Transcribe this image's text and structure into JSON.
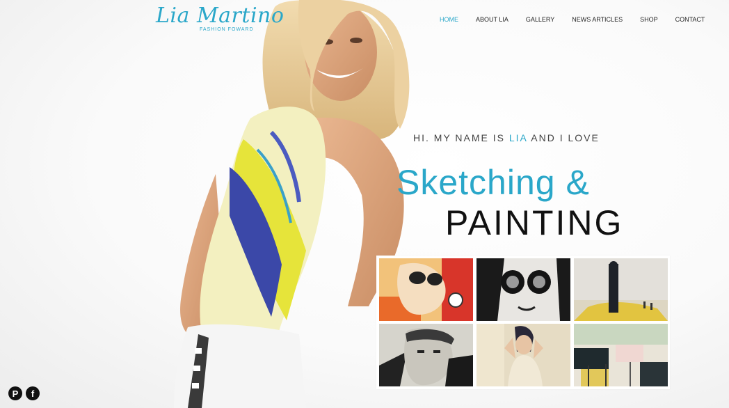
{
  "brand": {
    "name": "Lia Martino",
    "tagline": "FASHION FOWARD",
    "accent_color": "#2aa7c9"
  },
  "nav": {
    "items": [
      {
        "label": "HOME",
        "active": true
      },
      {
        "label": "ABOUT LIA",
        "active": false
      },
      {
        "label": "GALLERY",
        "active": false
      },
      {
        "label": "NEWS ARTICLES",
        "active": false
      },
      {
        "label": "SHOP",
        "active": false
      },
      {
        "label": "CONTACT",
        "active": false
      }
    ]
  },
  "hero": {
    "intro_before": "HI. MY NAME IS ",
    "intro_highlight": "LIA",
    "intro_after": " AND I LOVE",
    "line1": "Sketching &",
    "line2": "PAINTING"
  },
  "gallery": {
    "thumbnails": [
      {
        "icon": "artwork-sunglasses-colorful"
      },
      {
        "icon": "artwork-sunglasses-ink"
      },
      {
        "icon": "artwork-abstract-figure"
      },
      {
        "icon": "artwork-bandana-portrait"
      },
      {
        "icon": "artwork-woman-portrait"
      },
      {
        "icon": "artwork-abstract-drips"
      }
    ]
  },
  "social": [
    {
      "icon": "pinterest-icon",
      "glyph": "P"
    },
    {
      "icon": "facebook-icon",
      "glyph": "f"
    }
  ]
}
